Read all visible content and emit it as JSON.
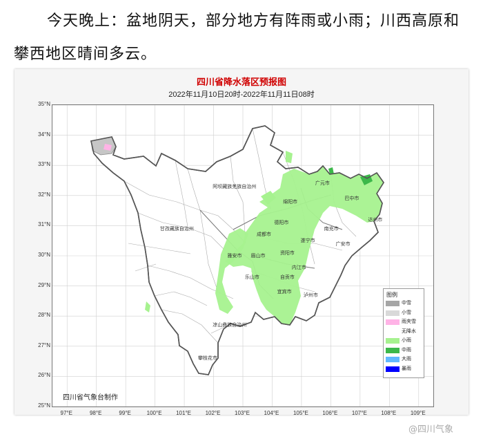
{
  "headline": {
    "line1": "今天晚上：盆地阴天，部分地方有阵雨或小雨；川西高原和",
    "line2": "攀西地区晴间多云。"
  },
  "map": {
    "title": "四川省降水落区预报图",
    "subtitle": "2022年11月10日20时-2022年11月11日08时",
    "credit": "四川省气象台制作",
    "lat_labels": [
      "35°N",
      "34°N",
      "33°N",
      "32°N",
      "31°N",
      "30°N",
      "29°N",
      "28°N",
      "27°N",
      "26°N",
      "25°N"
    ],
    "lon_labels": [
      "97°E",
      "98°E",
      "99°E",
      "100°E",
      "101°E",
      "102°E",
      "103°E",
      "104°E",
      "105°E",
      "106°E",
      "107°E",
      "108°E",
      "109°E"
    ],
    "cities": [
      {
        "name": "阿坝藏族羌族自治州",
        "lon": 102.3,
        "lat": 32.3
      },
      {
        "name": "甘孜藏族自治州",
        "lon": 100.5,
        "lat": 30.9
      },
      {
        "name": "凉山彝族自治州",
        "lon": 102.3,
        "lat": 27.7
      },
      {
        "name": "攀枝花市",
        "lon": 101.8,
        "lat": 26.6
      },
      {
        "name": "广元市",
        "lon": 105.8,
        "lat": 32.4
      },
      {
        "name": "巴中市",
        "lon": 106.8,
        "lat": 31.9
      },
      {
        "name": "绵阳市",
        "lon": 104.7,
        "lat": 31.8
      },
      {
        "name": "达州市",
        "lon": 107.6,
        "lat": 31.2
      },
      {
        "name": "德阳市",
        "lon": 104.4,
        "lat": 31.1
      },
      {
        "name": "南充市",
        "lon": 106.1,
        "lat": 30.9
      },
      {
        "name": "成都市",
        "lon": 103.8,
        "lat": 30.7
      },
      {
        "name": "遂宁市",
        "lon": 105.3,
        "lat": 30.5
      },
      {
        "name": "广安市",
        "lon": 106.5,
        "lat": 30.4
      },
      {
        "name": "资阳市",
        "lon": 104.6,
        "lat": 30.1
      },
      {
        "name": "雅安市",
        "lon": 102.8,
        "lat": 30.0
      },
      {
        "name": "眉山市",
        "lon": 103.6,
        "lat": 30.0
      },
      {
        "name": "内江市",
        "lon": 105.0,
        "lat": 29.6
      },
      {
        "name": "乐山市",
        "lon": 103.4,
        "lat": 29.3
      },
      {
        "name": "自贡市",
        "lon": 104.6,
        "lat": 29.3
      },
      {
        "name": "宜宾市",
        "lon": 104.5,
        "lat": 28.8
      },
      {
        "name": "泸州市",
        "lon": 105.4,
        "lat": 28.7
      }
    ],
    "legend": {
      "title": "图例",
      "items": [
        {
          "label": "中雪",
          "color": "#a6a6a6"
        },
        {
          "label": "小雪",
          "color": "#d9d9d9"
        },
        {
          "label": "雨夹雪",
          "color": "#ffb3e6"
        },
        {
          "label": "无降水",
          "color": "#ffffff"
        },
        {
          "label": "小雨",
          "color": "#a6f28f"
        },
        {
          "label": "中雨",
          "color": "#3cb84a"
        },
        {
          "label": "大雨",
          "color": "#61b8ff"
        },
        {
          "label": "暴雨",
          "color": "#0000fe"
        }
      ]
    }
  },
  "watermark": "@四川气象"
}
